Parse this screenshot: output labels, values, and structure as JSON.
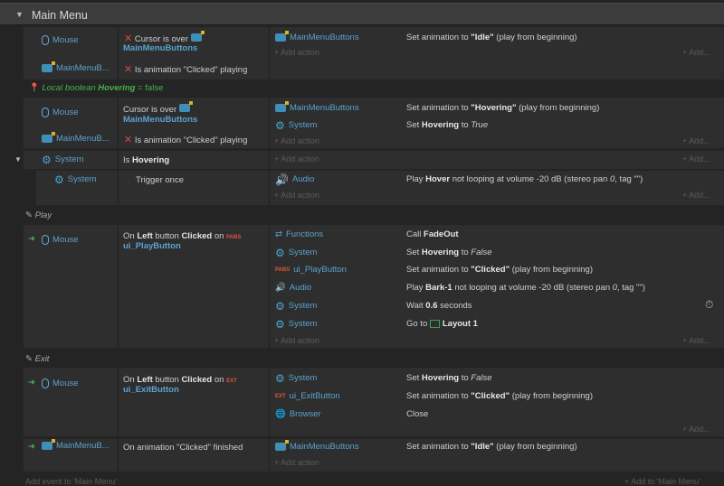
{
  "header": {
    "title": "Main Menu"
  },
  "rows": {
    "r1": {
      "c1_obj": "Mouse",
      "c1_text": "Cursor is over",
      "c1_link": "MainMenuButtons",
      "c2_obj": "MainMenuB...",
      "c2_text": "Is animation \"Clicked\" playing",
      "a1_obj": "MainMenuButtons",
      "a1_text_pre": "Set animation to ",
      "a1_bold": "\"Idle\"",
      "a1_text_post": " (play from beginning)",
      "add_action": "Add action",
      "add_right": "Add..."
    },
    "localvar": {
      "pre": "Local boolean ",
      "name": "Hovering",
      "post": " = false"
    },
    "r2": {
      "c1_obj": "Mouse",
      "c1_text": "Cursor is over",
      "c1_link": "MainMenuButtons",
      "c2_obj": "MainMenuB...",
      "c2_text": "Is animation \"Clicked\" playing",
      "a1_obj": "MainMenuButtons",
      "a1_pre": "Set animation to ",
      "a1_bold": "\"Hovering\"",
      "a1_post": " (play from beginning)",
      "a2_obj": "System",
      "a2_pre": "Set ",
      "a2_bold": "Hovering",
      "a2_mid": " to ",
      "a2_ital": "True",
      "add_action": "Add action",
      "add_right": "Add..."
    },
    "r3": {
      "c1_obj": "System",
      "c1_pre": "Is ",
      "c1_bold": "Hovering",
      "add_action": "Add action",
      "add_right": "Add..."
    },
    "r4": {
      "c1_obj": "System",
      "c1_text": "Trigger once",
      "a1_obj": "Audio",
      "a1_pre": "Play ",
      "a1_bold": "Hover",
      "a1_post": " not looping at volume -20 dB (stereo pan ",
      "a1_ital": "0",
      "a1_tail": ", tag \"\")",
      "add_action": "Add action",
      "add_right": "Add..."
    },
    "comment_play": "Play",
    "r5": {
      "c1_obj": "Mouse",
      "c1_pre": "On ",
      "c1_b1": "Left",
      "c1_mid": " button ",
      "c1_b2": "Clicked",
      "c1_on": " on ",
      "c1_link": "ui_PlayButton",
      "a1_obj": "Functions",
      "a1_pre": "Call ",
      "a1_bold": "FadeOut",
      "a2_obj": "System",
      "a2_pre": "Set ",
      "a2_bold": "Hovering",
      "a2_mid": " to ",
      "a2_ital": "False",
      "a3_obj": "ui_PlayButton",
      "a3_pre": "Set animation to ",
      "a3_bold": "\"Clicked\"",
      "a3_post": " (play from beginning)",
      "a4_obj": "Audio",
      "a4_pre": "Play ",
      "a4_bold": "Bark-1",
      "a4_post": " not looping at volume -20 dB (stereo pan ",
      "a4_ital": "0",
      "a4_tail": ", tag \"\")",
      "a5_obj": "System",
      "a5_pre": "Wait ",
      "a5_bold": "0.6",
      "a5_post": " seconds",
      "a6_obj": "System",
      "a6_pre": "Go to ",
      "a6_bold": "Layout 1",
      "add_action": "Add action",
      "add_right": "Add..."
    },
    "comment_exit": "Exit",
    "r6": {
      "c1_obj": "Mouse",
      "c1_pre": "On ",
      "c1_b1": "Left",
      "c1_mid": " button ",
      "c1_b2": "Clicked",
      "c1_on": " on ",
      "c1_link": "ui_ExitButton",
      "a1_obj": "System",
      "a1_pre": "Set ",
      "a1_bold": "Hovering",
      "a1_mid": " to ",
      "a1_ital": "False",
      "a2_obj": "ui_ExitButton",
      "a2_pre": "Set animation to ",
      "a2_bold": "\"Clicked\"",
      "a2_post": " (play from beginning)",
      "a3_obj": "Browser",
      "a3_text": "Close",
      "add_action": "Add action",
      "add_right": "Add..."
    },
    "r7": {
      "c1_obj": "MainMenuB...",
      "c1_text": "On animation \"Clicked\" finished",
      "a1_obj": "MainMenuButtons",
      "a1_pre": "Set animation to ",
      "a1_bold": "\"Idle\"",
      "a1_post": " (play from beginning)",
      "add_action": "Add action"
    }
  },
  "footer": {
    "add_event": "Add event to 'Main Menu'",
    "add_to": "Add to 'Main Menu'"
  },
  "colors": {
    "link": "#5aa2cf",
    "green": "#48b24a",
    "red": "#d9473f",
    "bg": "#242424",
    "panel": "#2e2e2e"
  }
}
